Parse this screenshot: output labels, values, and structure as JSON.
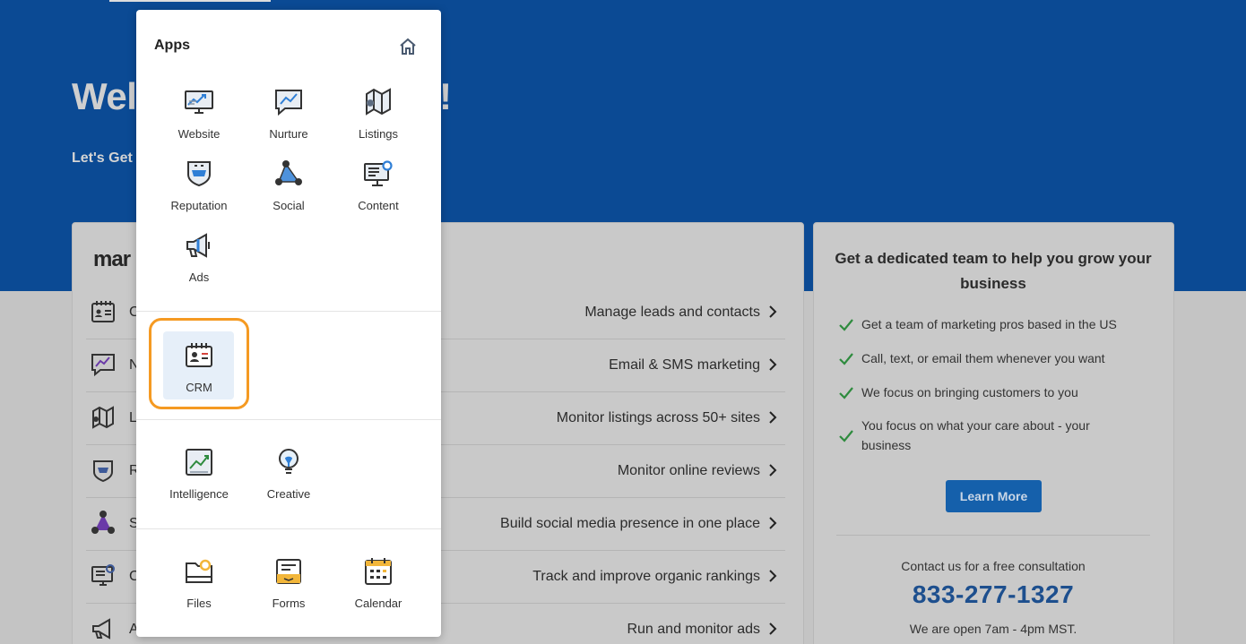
{
  "background": {
    "hero_title_start": "Wel",
    "hero_title_end": "!",
    "hero_subtitle": "Let's Get",
    "card_logo": "mar",
    "rows": [
      {
        "letter": "C",
        "icon": "crm-icon",
        "text": "Manage leads and contacts"
      },
      {
        "letter": "N",
        "icon": "nurture-icon",
        "text": "Email & SMS marketing"
      },
      {
        "letter": "L",
        "icon": "listings-icon",
        "text": "Monitor listings across 50+ sites"
      },
      {
        "letter": "R",
        "icon": "reputation-icon",
        "text": "Monitor online reviews"
      },
      {
        "letter": "S",
        "icon": "social-icon",
        "text": "Build social media presence in one place"
      },
      {
        "letter": "C",
        "icon": "content-icon",
        "text": "Track and improve organic rankings"
      },
      {
        "letter": "A",
        "icon": "ads-icon",
        "text": "Run and monitor ads"
      }
    ],
    "team_card": {
      "title": "Get a dedicated team to help you grow your business",
      "bullets": [
        "Get a team of marketing pros based in the US",
        "Call, text, or email them whenever you want",
        "We focus on bringing customers to you",
        "You focus on what your care about - your business"
      ],
      "learn_more": "Learn More",
      "contact": "Contact us for a free consultation",
      "phone": "833-277-1327",
      "hours": "We are open 7am - 4pm MST."
    }
  },
  "apps_menu": {
    "title": "Apps",
    "home_icon": "home-icon",
    "marketing": [
      {
        "label": "Website",
        "icon": "website-icon"
      },
      {
        "label": "Nurture",
        "icon": "nurture-icon"
      },
      {
        "label": "Listings",
        "icon": "listings-icon"
      },
      {
        "label": "Reputation",
        "icon": "reputation-icon"
      },
      {
        "label": "Social",
        "icon": "social-icon"
      },
      {
        "label": "Content",
        "icon": "content-icon"
      },
      {
        "label": "Ads",
        "icon": "ads-icon"
      }
    ],
    "crm": {
      "label": "CRM",
      "icon": "crm-icon"
    },
    "insights": [
      {
        "label": "Intelligence",
        "icon": "intelligence-icon"
      },
      {
        "label": "Creative",
        "icon": "creative-icon"
      }
    ],
    "tools": [
      {
        "label": "Files",
        "icon": "files-icon"
      },
      {
        "label": "Forms",
        "icon": "forms-icon"
      },
      {
        "label": "Calendar",
        "icon": "calendar-icon"
      }
    ]
  },
  "colors": {
    "hero_blue": "#0b4a94",
    "highlight_orange": "#f59a22",
    "crm_tile": "#e6eff9",
    "check_green": "#2e8b3e",
    "phone_blue": "#1d4f8e",
    "button_blue": "#1560ab"
  }
}
